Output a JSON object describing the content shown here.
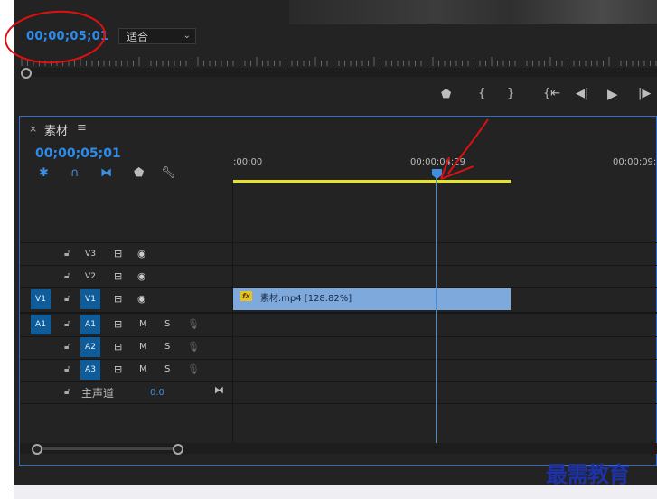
{
  "program_monitor": {
    "timecode": "00;00;05;01",
    "fit_label": "适合"
  },
  "playback_controls": [
    "mark-in-icon",
    "bracket-in-icon",
    "bracket-out-icon",
    "go-to-in-icon",
    "step-back-icon",
    "play-icon",
    "step-forward-icon"
  ],
  "timeline": {
    "tab_title": "素材",
    "timecode": "00;00;05;01",
    "ruler_labels": [
      ";00;00",
      "00;00;04;29",
      "00;00;09;2"
    ],
    "video_tracks": [
      {
        "source": "",
        "name": "V3"
      },
      {
        "source": "",
        "name": "V2"
      },
      {
        "source": "V1",
        "name": "V1"
      }
    ],
    "audio_tracks": [
      {
        "source": "A1",
        "name": "A1",
        "m": "M",
        "s": "S"
      },
      {
        "source": "",
        "name": "A2",
        "m": "M",
        "s": "S"
      },
      {
        "source": "",
        "name": "A3",
        "m": "M",
        "s": "S"
      }
    ],
    "master": {
      "label": "主声道",
      "value": "0.0"
    },
    "clip": {
      "fx": "fx",
      "label": "素材.mp4 [128.82%]"
    }
  },
  "watermark": "最需教育",
  "colors": {
    "accent": "#2d8ceb",
    "annotation": "#e01010",
    "clip": "#7ea9dc",
    "work_area": "#e6e12a"
  }
}
